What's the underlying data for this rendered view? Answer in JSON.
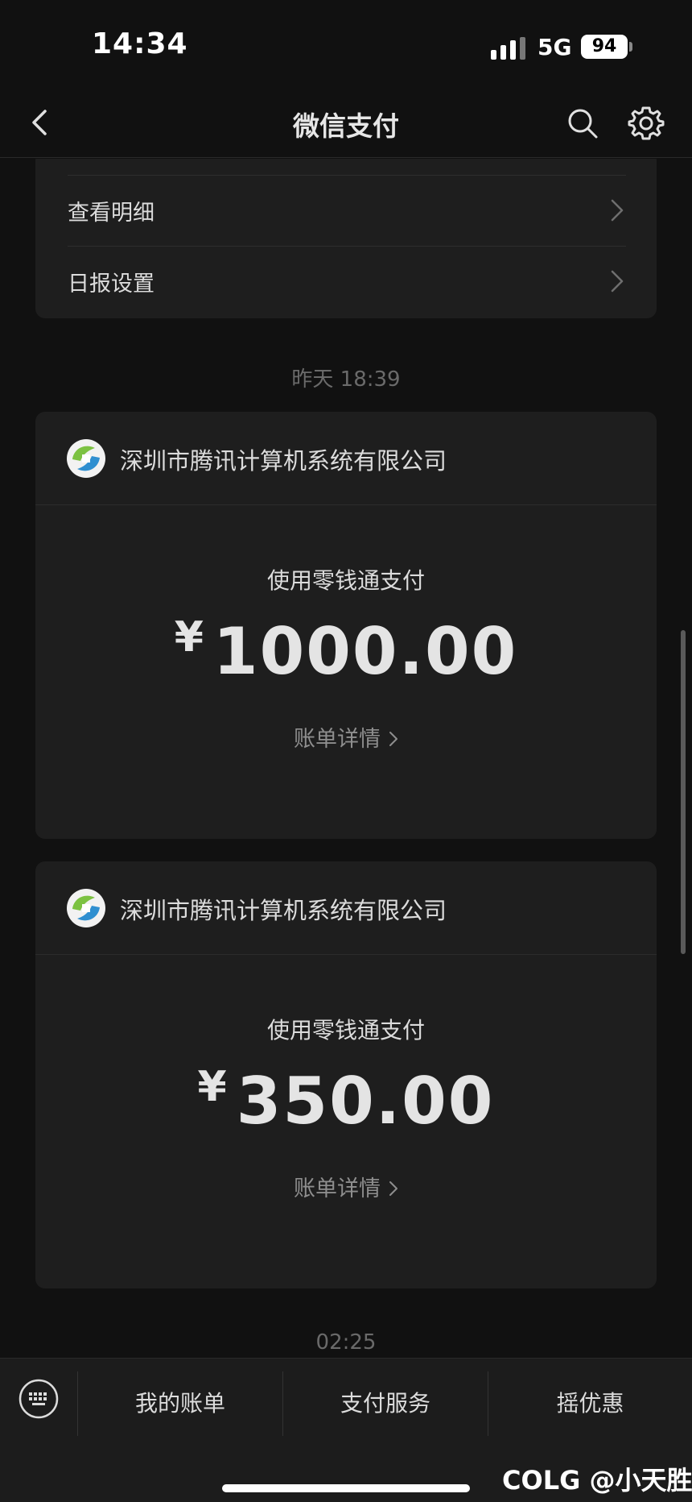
{
  "status_bar": {
    "time": "14:34",
    "network": "5G",
    "battery": "94"
  },
  "nav": {
    "title": "微信支付"
  },
  "menu": {
    "items": [
      {
        "label": "查看明细"
      },
      {
        "label": "日报设置"
      }
    ]
  },
  "messages": [
    {
      "timestamp": "昨天 18:39",
      "merchant": "深圳市腾讯计算机系统有限公司",
      "method": "使用零钱通支付",
      "currency": "¥",
      "amount": "1000.00",
      "detail_label": "账单详情"
    },
    {
      "timestamp": "02:25",
      "merchant": "深圳市腾讯计算机系统有限公司",
      "method": "使用零钱通支付",
      "currency": "¥",
      "amount": "350.00",
      "detail_label": "账单详情"
    }
  ],
  "bottom_tabs": [
    {
      "label": "我的账单"
    },
    {
      "label": "支付服务"
    },
    {
      "label": "摇优惠"
    }
  ],
  "watermark": "COLG @小天胜",
  "colors": {
    "background": "#111111",
    "card": "#1e1e1e",
    "text": "#dcdcdc",
    "muted": "#8e8e8e"
  }
}
